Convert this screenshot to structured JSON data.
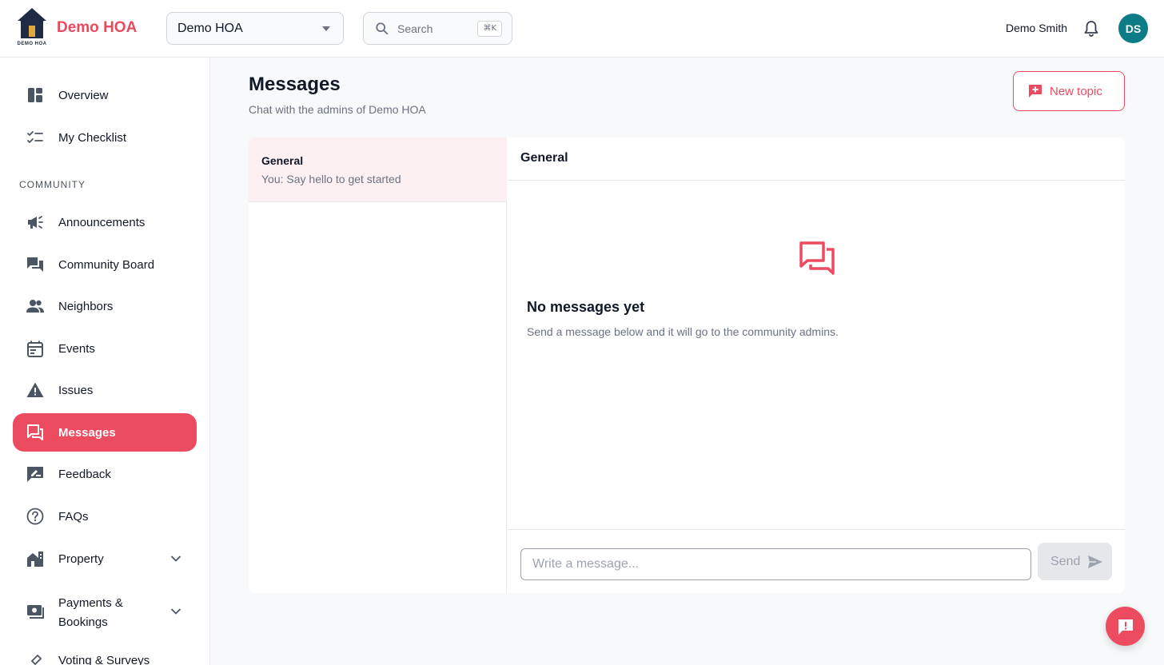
{
  "brand": {
    "name": "Demo HOA",
    "logo_caption": "DEMO HOA"
  },
  "header": {
    "hoa_select": {
      "value": "Demo HOA"
    },
    "search": {
      "label": "Search",
      "shortcut": "⌘K"
    },
    "user": {
      "name": "Demo Smith",
      "initials": "DS"
    }
  },
  "sidebar": {
    "section_label": "COMMUNITY",
    "items": [
      {
        "label": "Overview",
        "icon": "dashboard-icon"
      },
      {
        "label": "My Checklist",
        "icon": "checklist-icon"
      },
      {
        "label": "Announcements",
        "icon": "megaphone-icon"
      },
      {
        "label": "Community Board",
        "icon": "forum-icon"
      },
      {
        "label": "Neighbors",
        "icon": "people-icon"
      },
      {
        "label": "Events",
        "icon": "calendar-icon"
      },
      {
        "label": "Issues",
        "icon": "warning-icon"
      },
      {
        "label": "Messages",
        "icon": "chat-icon",
        "active": true
      },
      {
        "label": "Feedback",
        "icon": "feedback-icon"
      },
      {
        "label": "FAQs",
        "icon": "help-icon"
      },
      {
        "label": "Property",
        "icon": "building-icon",
        "expandable": true
      },
      {
        "label_line1": "Payments &",
        "label_line2": "Bookings",
        "icon": "payments-icon",
        "expandable": true
      },
      {
        "label": "Voting & Surveys",
        "icon": "vote-icon"
      }
    ]
  },
  "main": {
    "title": "Messages",
    "subtitle": "Chat with the admins of Demo HOA",
    "new_topic_label": "New topic",
    "topics": [
      {
        "name": "General",
        "preview": "You: Say hello to get started",
        "selected": true
      }
    ],
    "chat": {
      "title": "General",
      "empty_title": "No messages yet",
      "empty_subtitle": "Send a message below and it will go to the community admins.",
      "input_placeholder": "Write a message...",
      "send_label": "Send"
    }
  },
  "colors": {
    "accent": "#ec4b60",
    "brand_text": "#e84a5f",
    "avatar_bg": "#0e7c86",
    "selected_topic_bg": "#fdf0f2"
  }
}
